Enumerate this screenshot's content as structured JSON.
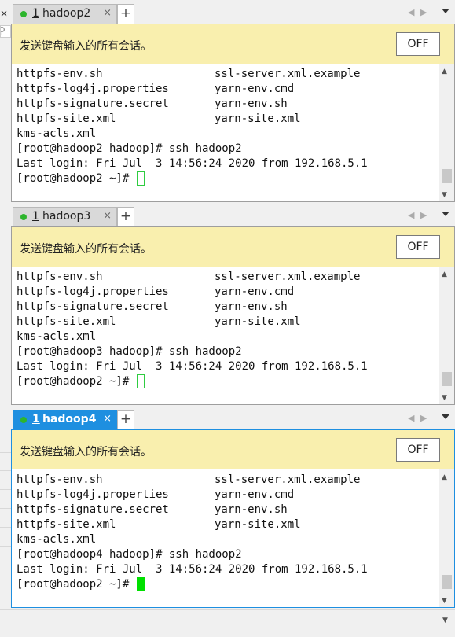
{
  "left_pane": {
    "close_glyph": "×",
    "search_icon": "search-icon"
  },
  "panels": [
    {
      "tab": {
        "index": "1",
        "name": "hadoop2",
        "close": "×",
        "add": "+"
      },
      "banner": {
        "text": "发送键盘输入的所有会话。",
        "button": "OFF"
      },
      "lines": [
        {
          "a": "httpfs-env.sh",
          "b": "ssl-server.xml.example"
        },
        {
          "a": "httpfs-log4j.properties",
          "b": "yarn-env.cmd"
        },
        {
          "a": "httpfs-signature.secret",
          "b": "yarn-env.sh"
        },
        {
          "a": "httpfs-site.xml",
          "b": "yarn-site.xml"
        },
        {
          "a": "kms-acls.xml",
          "b": ""
        },
        {
          "a": "[root@hadoop2 hadoop]# ssh hadoop2",
          "b": ""
        },
        {
          "a": "Last login: Fri Jul  3 14:56:24 2020 from 192.168.5.1",
          "b": ""
        },
        {
          "a": "[root@hadoop2 ~]# ",
          "b": ""
        }
      ]
    },
    {
      "tab": {
        "index": "1",
        "name": "hadoop3",
        "close": "×",
        "add": "+"
      },
      "banner": {
        "text": "发送键盘输入的所有会话。",
        "button": "OFF"
      },
      "lines": [
        {
          "a": "httpfs-env.sh",
          "b": "ssl-server.xml.example"
        },
        {
          "a": "httpfs-log4j.properties",
          "b": "yarn-env.cmd"
        },
        {
          "a": "httpfs-signature.secret",
          "b": "yarn-env.sh"
        },
        {
          "a": "httpfs-site.xml",
          "b": "yarn-site.xml"
        },
        {
          "a": "kms-acls.xml",
          "b": ""
        },
        {
          "a": "[root@hadoop3 hadoop]# ssh hadoop2",
          "b": ""
        },
        {
          "a": "Last login: Fri Jul  3 14:56:24 2020 from 192.168.5.1",
          "b": ""
        },
        {
          "a": "[root@hadoop2 ~]# ",
          "b": ""
        }
      ]
    },
    {
      "tab": {
        "index": "1",
        "name": "hadoop4",
        "close": "×",
        "add": "+"
      },
      "banner": {
        "text": "发送键盘输入的所有会话。",
        "button": "OFF"
      },
      "lines": [
        {
          "a": "httpfs-env.sh",
          "b": "ssl-server.xml.example"
        },
        {
          "a": "httpfs-log4j.properties",
          "b": "yarn-env.cmd"
        },
        {
          "a": "httpfs-signature.secret",
          "b": "yarn-env.sh"
        },
        {
          "a": "httpfs-site.xml",
          "b": "yarn-site.xml"
        },
        {
          "a": "kms-acls.xml",
          "b": ""
        },
        {
          "a": "[root@hadoop4 hadoop]# ssh hadoop2",
          "b": ""
        },
        {
          "a": "Last login: Fri Jul  3 14:56:24 2020 from 192.168.5.1",
          "b": ""
        },
        {
          "a": "[root@hadoop2 ~]# ",
          "b": ""
        }
      ]
    }
  ],
  "colors": {
    "active_tab": "#1e8fe0",
    "banner": "#f9efae",
    "cursor": "#00e000",
    "status_dot": "#2db52d"
  }
}
